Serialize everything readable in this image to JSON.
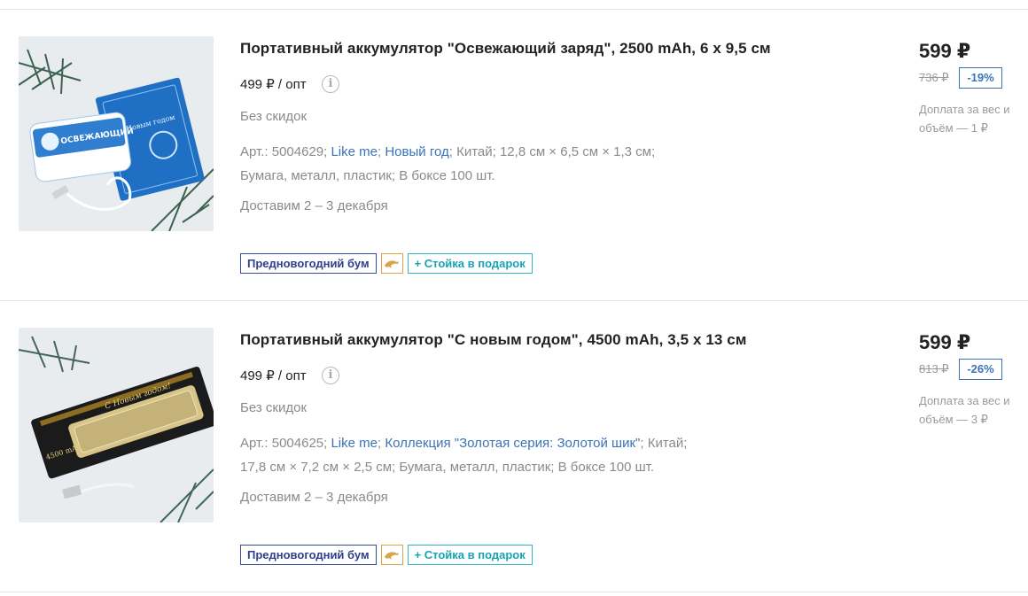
{
  "products": [
    {
      "title": "Портативный аккумулятор \"Освежающий заряд\", 2500 mAh, 6 х 9,5 см",
      "opt_price": "499 ₽ / опт",
      "no_discount": "Без скидок",
      "specs_line1": [
        {
          "text": "Арт.: 5004629",
          "link": false
        },
        {
          "text": "Like me",
          "link": true
        },
        {
          "text": "Новый год",
          "link": true
        },
        {
          "text": "Китай",
          "link": false
        },
        {
          "text": "12,8 см × 6,5 см × 1,3 см",
          "link": false
        }
      ],
      "specs_line2": [
        {
          "text": "Бумага, металл, пластик",
          "link": false
        },
        {
          "text": "В боксе 100 шт.",
          "link": false
        }
      ],
      "delivery": "Доставим 2 – 3 декабря",
      "badges": {
        "promo": "Предновогодний бум",
        "gift": "+ Стойка в подарок",
        "icon": "dolphin-icon"
      },
      "price": "599 ₽",
      "old_price": "736 ₽",
      "discount": "-19%",
      "surcharge": "Доплата за вес и объём — 1 ₽"
    },
    {
      "title": "Портативный аккумулятор \"С новым годом\", 4500 mAh, 3,5 х 13 см",
      "opt_price": "499 ₽ / опт",
      "no_discount": "Без скидок",
      "specs_line1": [
        {
          "text": "Арт.: 5004625",
          "link": false
        },
        {
          "text": "Like me",
          "link": true
        },
        {
          "text": "Коллекция \"Золотая серия: Золотой шик\"",
          "link": true
        },
        {
          "text": "Китай",
          "link": false
        }
      ],
      "specs_line2": [
        {
          "text": "17,8 см × 7,2 см × 2,5 см",
          "link": false
        },
        {
          "text": "Бумага, металл, пластик",
          "link": false
        },
        {
          "text": "В боксе 100 шт.",
          "link": false
        }
      ],
      "delivery": "Доставим 2 – 3 декабря",
      "badges": {
        "promo": "Предновогодний бум",
        "gift": "+ Стойка в подарок",
        "icon": "dolphin-icon"
      },
      "price": "599 ₽",
      "old_price": "813 ₽",
      "discount": "-26%",
      "surcharge": "Доплата за вес и объём — 3 ₽"
    }
  ],
  "image_texts": {
    "p1_brand": "ОСВЕЖАЮЩИЙ",
    "p1_box": "С Новым годом",
    "p2_greeting": "С Новым годом!",
    "p2_capacity": "4500 mAh"
  },
  "info_icon": "i",
  "colors": {
    "link": "#3a73b8",
    "promo_badge": "#2e3f8e",
    "gift_badge": "#1aa3b3",
    "muted_text": "#8a8a8a"
  }
}
